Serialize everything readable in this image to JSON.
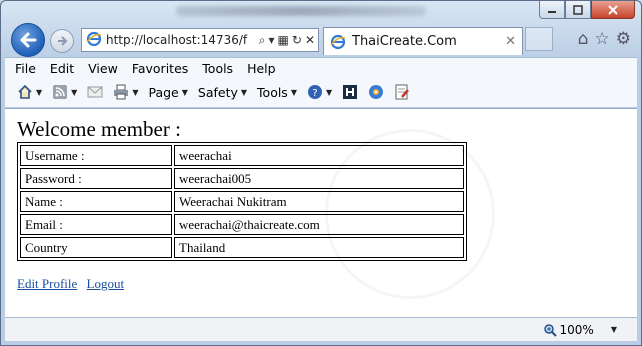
{
  "browser": {
    "address_url": "http://localhost:14736/f",
    "tab_title": "ThaiCreate.Com",
    "menu": [
      "File",
      "Edit",
      "View",
      "Favorites",
      "Tools",
      "Help"
    ],
    "commands": {
      "page": "Page",
      "safety": "Safety",
      "tools": "Tools"
    },
    "zoom": "100%"
  },
  "page": {
    "heading": "Welcome member :",
    "rows": [
      {
        "label": "Username :",
        "value": "weerachai"
      },
      {
        "label": "Password :",
        "value": "weerachai005"
      },
      {
        "label": "Name :",
        "value": "Weerachai Nukitram"
      },
      {
        "label": "Email :",
        "value": "weerachai@thaicreate.com"
      },
      {
        "label": "Country",
        "value": "Thailand"
      }
    ],
    "links": {
      "edit_profile": "Edit Profile",
      "logout": "Logout"
    }
  },
  "colors": {
    "link": "#1a4fa0",
    "close_button": "#c7432a",
    "back_button": "#1f5fb8"
  }
}
